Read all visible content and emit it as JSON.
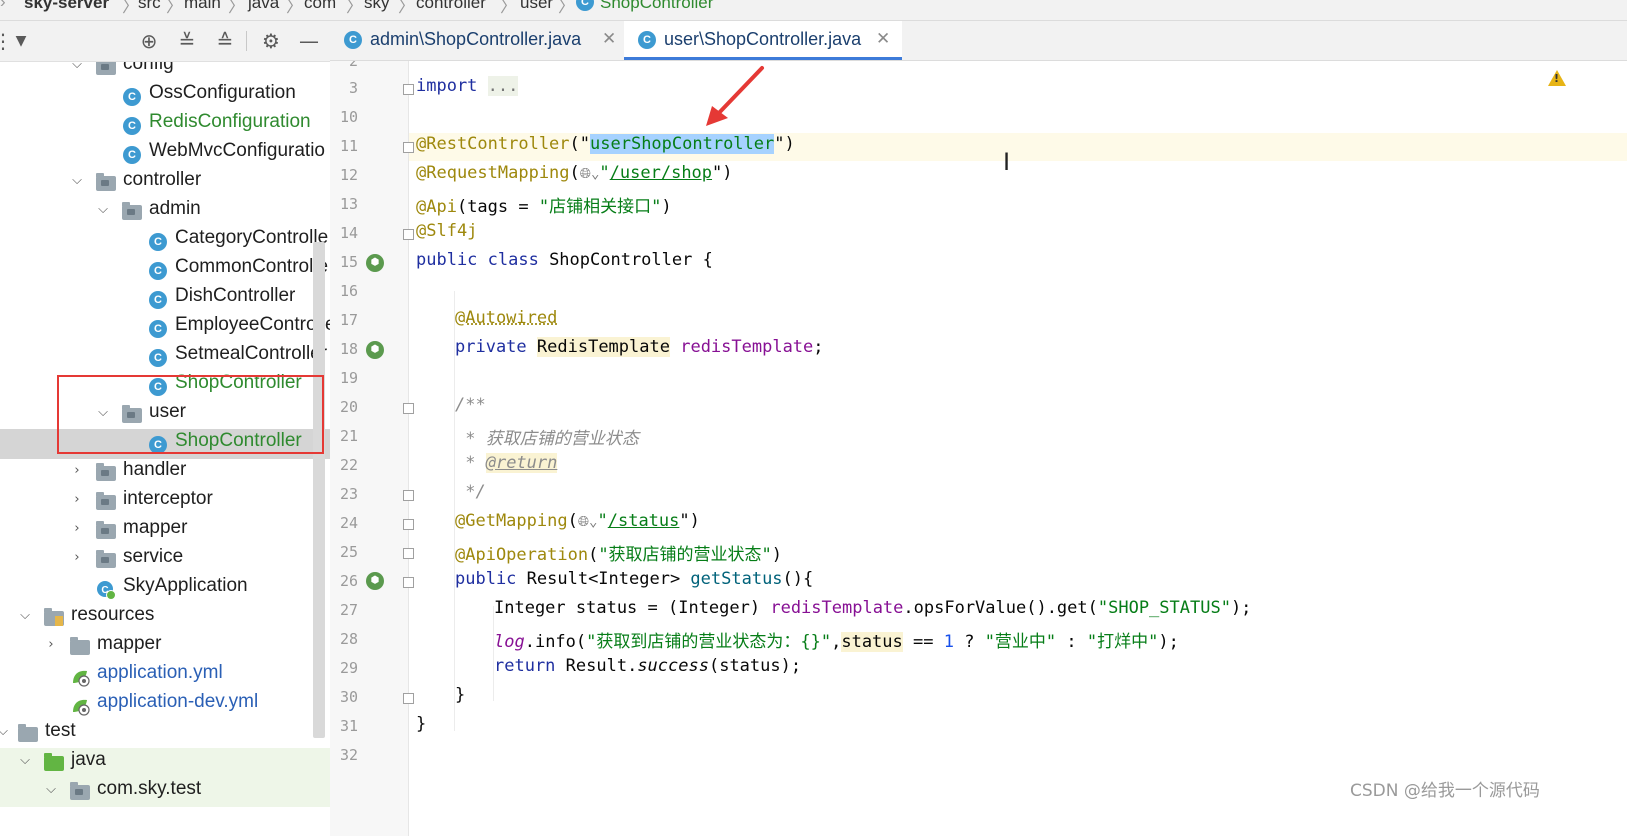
{
  "breadcrumb": {
    "items": [
      "sky-server",
      "src",
      "main",
      "java",
      "com",
      "sky",
      "controller",
      "user",
      "ShopController"
    ]
  },
  "project_toolbar": {
    "icons": [
      "chevron-down-icon",
      "locate-icon",
      "expand-all-icon",
      "collapse-all-icon",
      "gear-icon",
      "hide-icon"
    ]
  },
  "tree": {
    "items": [
      {
        "label": "config",
        "type": "folder",
        "expanded": true
      },
      {
        "label": "OssConfiguration",
        "type": "class"
      },
      {
        "label": "RedisConfiguration",
        "type": "class",
        "status": "new"
      },
      {
        "label": "WebMvcConfiguratio",
        "type": "class"
      },
      {
        "label": "controller",
        "type": "folder",
        "expanded": true
      },
      {
        "label": "admin",
        "type": "folder",
        "expanded": true
      },
      {
        "label": "CategoryControlle",
        "type": "class"
      },
      {
        "label": "CommonControlle",
        "type": "class"
      },
      {
        "label": "DishController",
        "type": "class"
      },
      {
        "label": "EmployeeControlle",
        "type": "class"
      },
      {
        "label": "SetmealController",
        "type": "class"
      },
      {
        "label": "ShopController",
        "type": "class",
        "status": "new"
      },
      {
        "label": "user",
        "type": "folder",
        "expanded": true
      },
      {
        "label": "ShopController",
        "type": "class",
        "status": "new",
        "selected": true
      },
      {
        "label": "handler",
        "type": "folder",
        "expanded": false
      },
      {
        "label": "interceptor",
        "type": "folder",
        "expanded": false
      },
      {
        "label": "mapper",
        "type": "folder",
        "expanded": false
      },
      {
        "label": "service",
        "type": "folder",
        "expanded": false
      },
      {
        "label": "SkyApplication",
        "type": "spring-app"
      },
      {
        "label": "resources",
        "type": "resources-folder",
        "expanded": true
      },
      {
        "label": "mapper",
        "type": "folder",
        "expanded": false
      },
      {
        "label": "application.yml",
        "type": "yaml"
      },
      {
        "label": "application-dev.yml",
        "type": "yaml"
      },
      {
        "label": "test",
        "type": "folder",
        "expanded": true
      },
      {
        "label": "java",
        "type": "test-folder",
        "expanded": true
      },
      {
        "label": "com.sky.test",
        "type": "folder",
        "expanded": true
      }
    ]
  },
  "tabs": [
    {
      "label": "admin\\ShopController.java",
      "active": false
    },
    {
      "label": "user\\ShopController.java",
      "active": true
    }
  ],
  "editor": {
    "line_numbers": [
      "2",
      "3",
      "10",
      "11",
      "12",
      "13",
      "14",
      "15",
      "16",
      "17",
      "18",
      "19",
      "20",
      "21",
      "22",
      "23",
      "24",
      "25",
      "26",
      "27",
      "28",
      "29",
      "30",
      "31",
      "32"
    ],
    "code": {
      "l3_kw": "import",
      "l3_fold": "...",
      "l11_ann": "@RestController",
      "l11_open": "(\"",
      "l11_str": "userShopController",
      "l11_close": "\")",
      "l12_ann": "@RequestMapping",
      "l12_open": "(",
      "l12_q1": "\"",
      "l12_str": "/user/shop",
      "l12_close": "\")",
      "l13_ann": "@Api",
      "l13_rest": "(tags = ",
      "l13_str": "\"店铺相关接口\"",
      "l13_close": ")",
      "l14_ann": "@Slf4j",
      "l15_kw": "public class",
      "l15_rest": " ShopController {",
      "l17_ann": "@Autowired",
      "l18_kw": "private",
      "l18_type": "RedisTemplate",
      "l18_field": "redisTemplate",
      "l18_end": ";",
      "l20": "/**",
      "l21": " * 获取店铺的营业状态",
      "l22_star": " * ",
      "l22_tag": "@return",
      "l23": " */",
      "l24_ann": "@GetMapping",
      "l24_open": "(",
      "l24_q1": "\"",
      "l24_str": "/status",
      "l24_close": "\")",
      "l25_ann": "@ApiOperation",
      "l25_open": "(",
      "l25_str": "\"获取店铺的营业状态\"",
      "l25_close": ")",
      "l26_kw": "public",
      "l26_rest": " Result<Integer> ",
      "l26_method": "getStatus",
      "l26_end": "(){",
      "l27_a": "Integer status = (Integer) ",
      "l27_field": "redisTemplate",
      "l27_b": ".opsForValue().get(",
      "l27_str": "\"SHOP_STATUS\"",
      "l27_end": ");",
      "l28_log": "log",
      "l28_a": ".info(",
      "l28_str": "\"获取到店铺的营业状态为：{}\"",
      "l28_comma": ",",
      "l28_status": "status",
      "l28_eq": " == ",
      "l28_num": "1",
      "l28_q": " ? ",
      "l28_s1": "\"营业中\"",
      "l28_colon": " : ",
      "l28_s2": "\"打烊中\"",
      "l28_end": ");",
      "l29_kw": "return",
      "l29_a": " Result.",
      "l29_method": "success",
      "l29_end": "(status);",
      "l30": "}",
      "l31": "}"
    }
  },
  "watermark": "CSDN @给我一个源代码",
  "colors": {
    "annotation": "#9e880d",
    "keyword": "#1f2fa0",
    "string": "#067d17",
    "comment": "#8c8c8c",
    "field": "#871094",
    "selection": "#a6d2ff",
    "red_highlight": "#e53935",
    "new_file_green": "#2f8a2f"
  }
}
